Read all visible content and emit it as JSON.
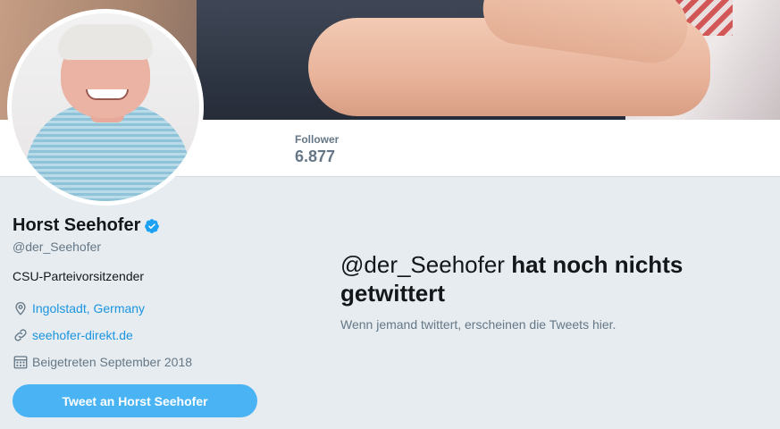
{
  "profile": {
    "name": "Horst Seehofer",
    "handle": "@der_Seehofer",
    "bio": "CSU-Parteivorsitzender",
    "location": "Ingolstadt, Germany",
    "website": "seehofer-direkt.de",
    "joined": "Beigetreten September 2018"
  },
  "stats": {
    "followers_label": "Follower",
    "followers_value": "6.877"
  },
  "actions": {
    "tweet_to_label": "Tweet an Horst Seehofer"
  },
  "empty_state": {
    "handle": "@der_Seehofer",
    "title_rest": " hat noch nichts getwittert",
    "subtitle": "Wenn jemand twittert, erscheinen die Tweets hier."
  },
  "colors": {
    "accent": "#1b95e0",
    "button": "#4ab3f4",
    "background": "#e6ecf0",
    "muted": "#657786"
  },
  "icons": {
    "verified": "verified-badge-icon",
    "location": "location-pin-icon",
    "website": "link-icon",
    "joined": "calendar-icon"
  }
}
